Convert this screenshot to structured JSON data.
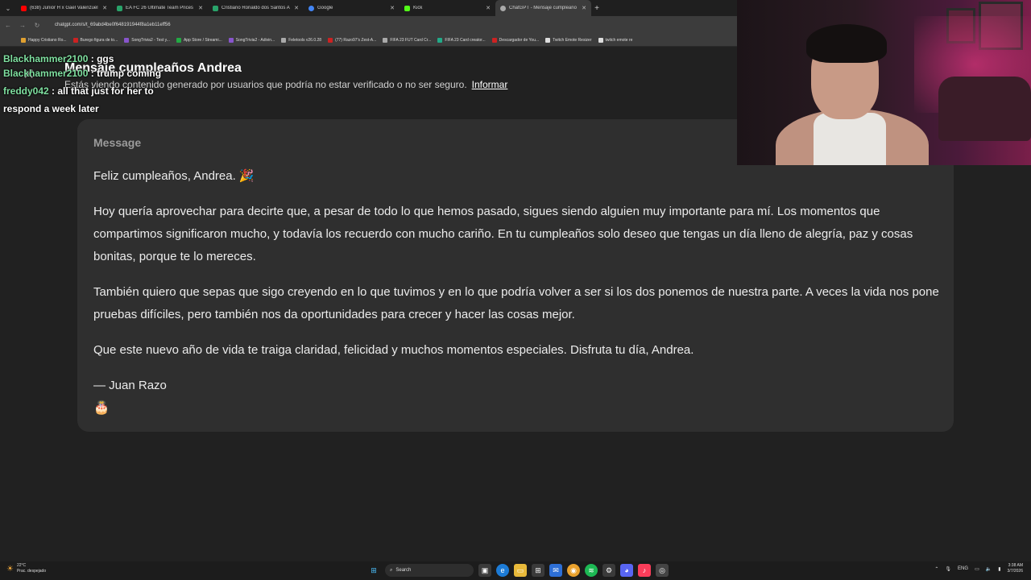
{
  "browser": {
    "tabs": [
      {
        "label": "(638) Junior H x Gael Valenzuel",
        "color": "#ff0000"
      },
      {
        "label": "EA FC 26 Ultimate Team Prices",
        "color": "#29a36a"
      },
      {
        "label": "Cristiano Ronaldo dos Santos A",
        "color": "#29a36a"
      },
      {
        "label": "Google",
        "color": "#4285f4"
      },
      {
        "label": "Kick",
        "color": "#53fc18"
      },
      {
        "label": "ChatGPT - Mensaje cumpleaño",
        "color": "#aaaaaa"
      }
    ],
    "url": "chatgpt.com/s/t_69abd4be0f648191944f8a1eb11eff56",
    "bookmarks": [
      {
        "label": "Happy Cristiano Ro...",
        "color": "#e0a030"
      },
      {
        "label": "Burego figura de to...",
        "color": "#cc2222"
      },
      {
        "label": "SongTrivia2 - Test y...",
        "color": "#8855cc"
      },
      {
        "label": "App Store / Streami...",
        "color": "#22aa44"
      },
      {
        "label": "SongTrivia2 - Adivin...",
        "color": "#8855cc"
      },
      {
        "label": "Feletools v26.0.28",
        "color": "#aaaaaa"
      },
      {
        "label": "(77) Razo97's Zest-A...",
        "color": "#cc2222"
      },
      {
        "label": "FIFA 23 FUT Card Cr...",
        "color": "#aaaaaa"
      },
      {
        "label": "FIFA 23 Card creator...",
        "color": "#22aa88"
      },
      {
        "label": "Descargador de You...",
        "color": "#cc2222"
      },
      {
        "label": "Twitch Emote Resizer",
        "color": "#dddddd"
      },
      {
        "label": "twitch emote re",
        "color": "#dddddd"
      }
    ]
  },
  "page": {
    "title": "Mensaje cumpleaños Andrea",
    "warning": "Estás viendo contenido generado por usuarios que podría no estar verificado o no ser seguro.",
    "report_link": "Informar",
    "message_label": "Message",
    "paragraphs": [
      "Feliz cumpleaños, Andrea. 🎉",
      "Hoy quería aprovechar para decirte que, a pesar de todo lo que hemos pasado, sigues siendo alguien muy importante para mí. Los momentos que compartimos significaron mucho, y todavía los recuerdo con mucho cariño. En tu cumpleaños solo deseo que tengas un día lleno de alegría, paz y cosas bonitas, porque te lo mereces.",
      "También quiero que sepas que sigo creyendo en lo que tuvimos y en lo que podría volver a ser si los dos ponemos de nuestra parte. A veces la vida nos pone pruebas difíciles, pero también nos da oportunidades para crecer y hacer las cosas mejor.",
      "Que este nuevo año de vida te traiga claridad, felicidad y muchos momentos especiales. Disfruta tu día, Andrea.",
      "— Juan Razo"
    ],
    "cake": "🎂"
  },
  "chat": [
    {
      "user": "Blackhammer2100",
      "text": "ggs"
    },
    {
      "user": "Blackhammer2100",
      "text": "trump coming"
    },
    {
      "user": "freddy042",
      "text": "all that just for her to respond a week later"
    }
  ],
  "taskbar": {
    "weather_temp": "22°C",
    "weather_desc": "Prac. despejado",
    "search_label": "Search",
    "lang": "ENG",
    "time": "3:38 AM",
    "date": "3/7/2026"
  }
}
